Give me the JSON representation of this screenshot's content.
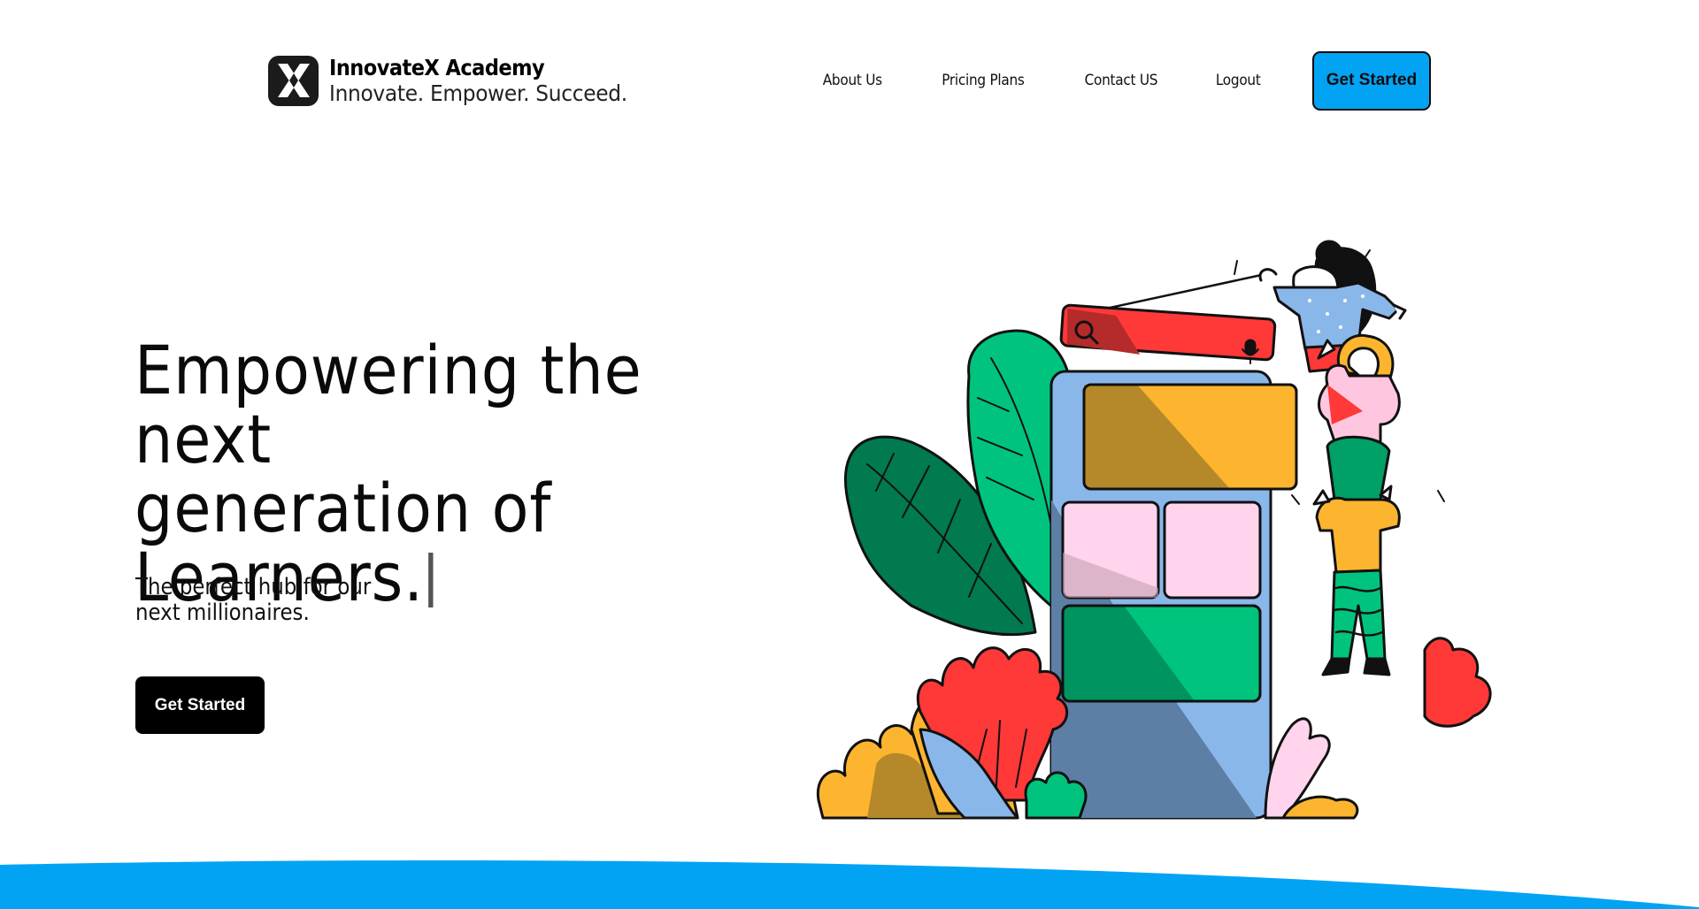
{
  "header": {
    "brand_name": "InnovateX Academy",
    "brand_tagline": "Innovate. Empower. Succeed.",
    "logo_icon": "x-logo-icon",
    "nav": [
      {
        "label": "About Us"
      },
      {
        "label": "Pricing Plans"
      },
      {
        "label": "Contact US"
      },
      {
        "label": "Logout"
      }
    ],
    "cta_label": "Get Started"
  },
  "hero": {
    "title_line1": "Empowering the next",
    "title_line2": "generation of",
    "title_line3": "Learners.",
    "subtitle_line1": "The perfect hub for our",
    "subtitle_line2": "next millionaires.",
    "cta_label": "Get Started"
  },
  "colors": {
    "accent": "#03a3f4",
    "cta_dark": "#000000",
    "illustration_yellow": "#fdb52f",
    "illustration_green": "#00c47d",
    "illustration_red": "#ff3838",
    "illustration_pink": "#ffd4ec",
    "illustration_blue": "#8ab7ea"
  }
}
